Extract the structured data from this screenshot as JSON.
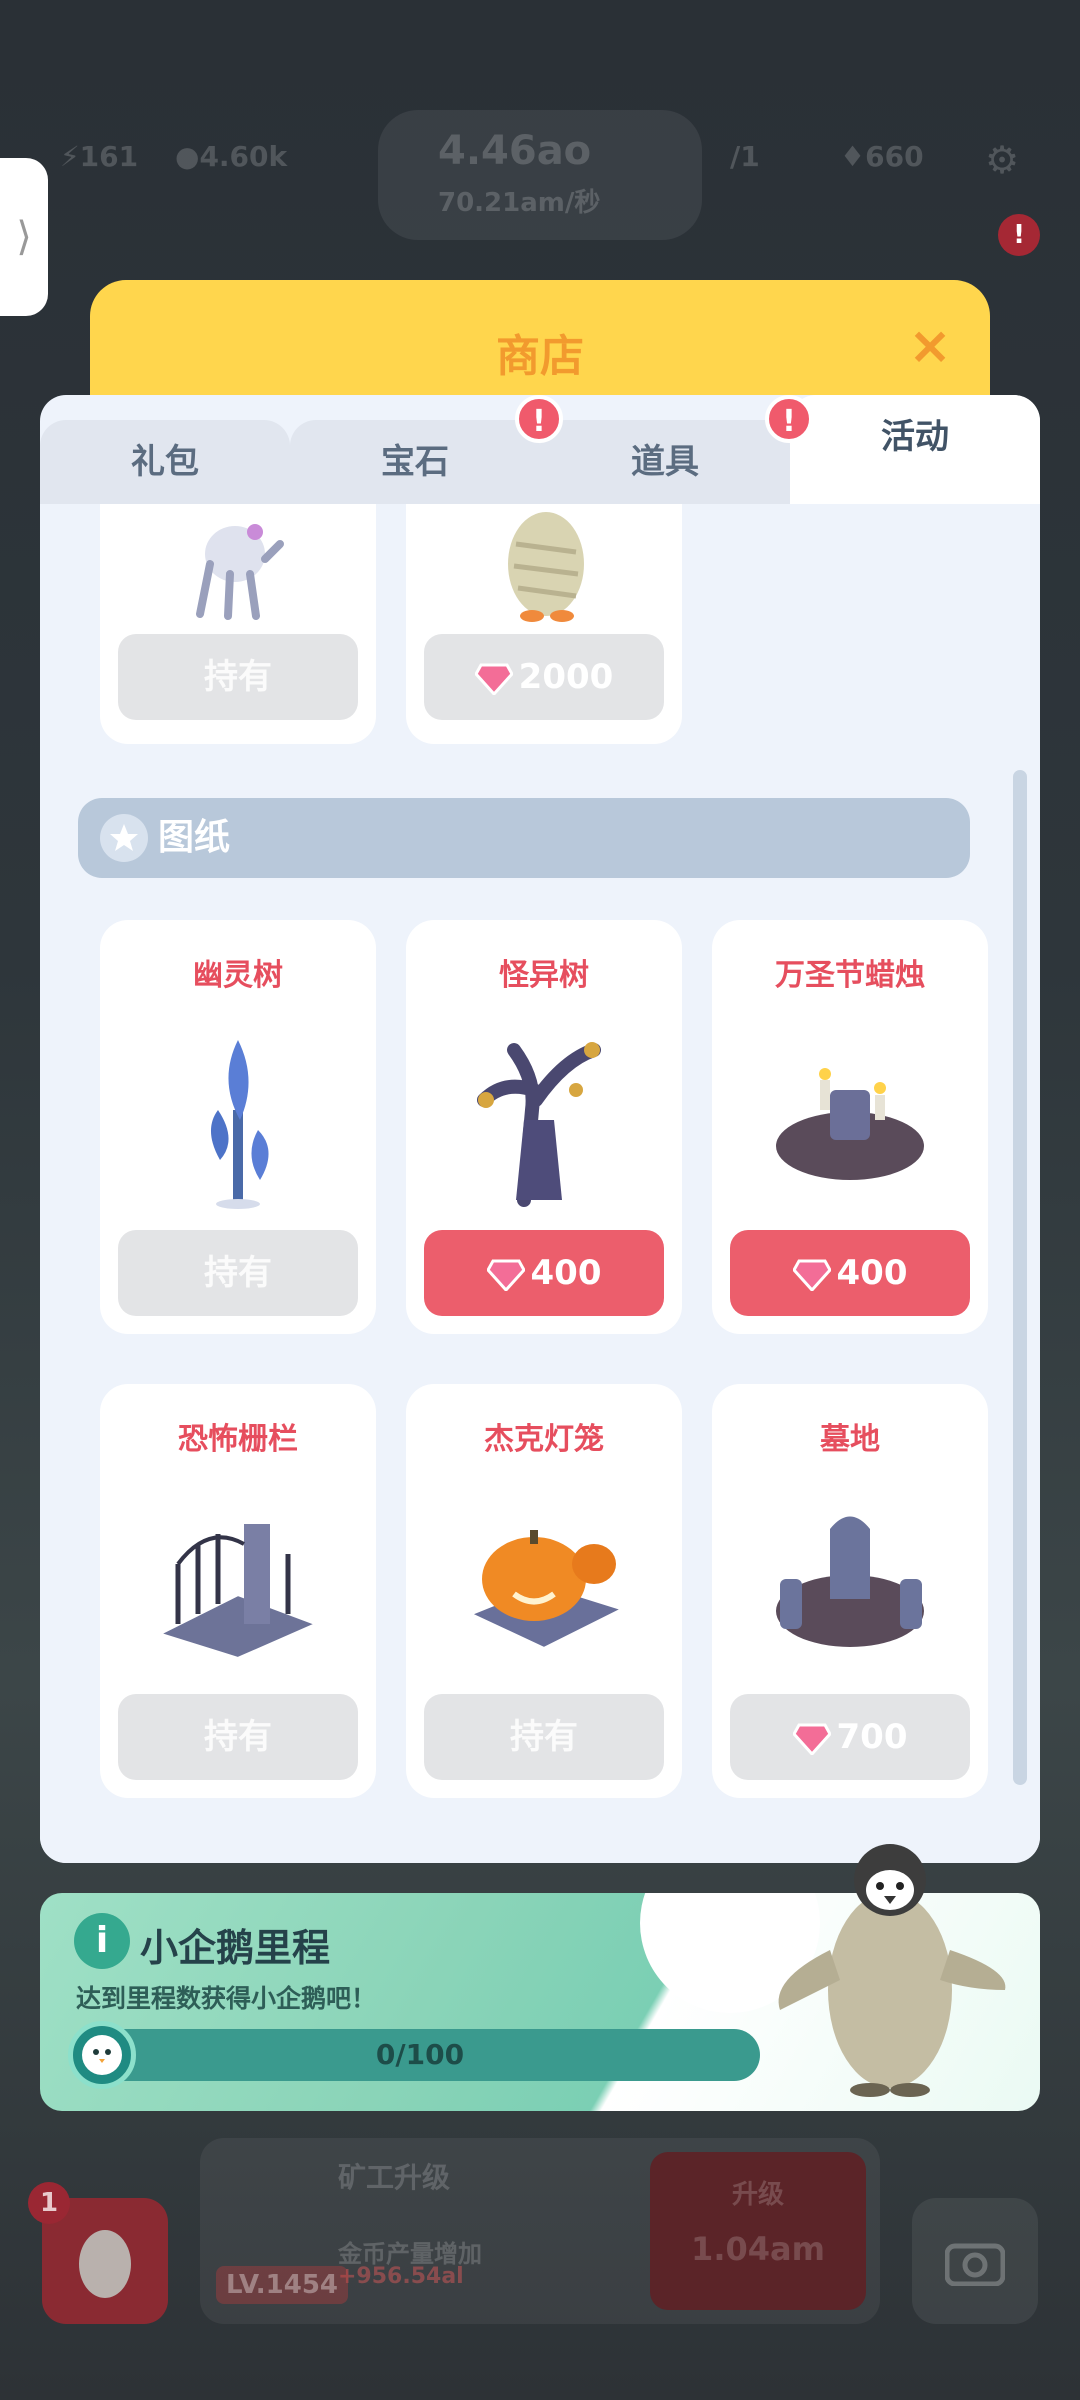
{
  "hud": {
    "stat1": "161",
    "stat2": "4.60k",
    "coins": "4.46ao",
    "coins_rate": "70.21am/秒",
    "stat3": "1",
    "gems": "660",
    "notif_badge": "!"
  },
  "shop": {
    "title": "商店",
    "tabs": [
      {
        "label": "礼包",
        "alert": false
      },
      {
        "label": "宝石",
        "alert": true
      },
      {
        "label": "道具",
        "alert": true
      },
      {
        "label": "活动",
        "alert": false
      }
    ],
    "alert_symbol": "!",
    "top_items": [
      {
        "button": "持有",
        "state": "owned"
      },
      {
        "button": "2000",
        "state": "price-grey"
      }
    ],
    "section_title": "图纸",
    "items": [
      {
        "name": "幽灵树",
        "button": "持有",
        "state": "owned"
      },
      {
        "name": "怪异树",
        "button": "400",
        "state": "price-red"
      },
      {
        "name": "万圣节蜡烛",
        "button": "400",
        "state": "price-red"
      },
      {
        "name": "恐怖栅栏",
        "button": "持有",
        "state": "owned"
      },
      {
        "name": "杰克灯笼",
        "button": "持有",
        "state": "owned"
      },
      {
        "name": "墓地",
        "button": "700",
        "state": "price-grey"
      }
    ]
  },
  "milestone": {
    "title": "小企鹅里程",
    "subtitle": "达到里程数获得小企鹅吧！",
    "progress_text": "0/100",
    "progress": 0.0
  },
  "bottom": {
    "egg_badge": "1",
    "upgrade_title": "矿工升级",
    "upgrade_desc": "金币产量增加",
    "upgrade_amount": "+956.54al",
    "level": "LV.1454",
    "upgrade_button": "升级",
    "upgrade_cost": "1.04am"
  },
  "colors": {
    "accent_yellow": "#ffd64d",
    "price_red": "#ec5e6c",
    "title_orange": "#f29a2e",
    "item_name_red": "#e64e5e"
  }
}
